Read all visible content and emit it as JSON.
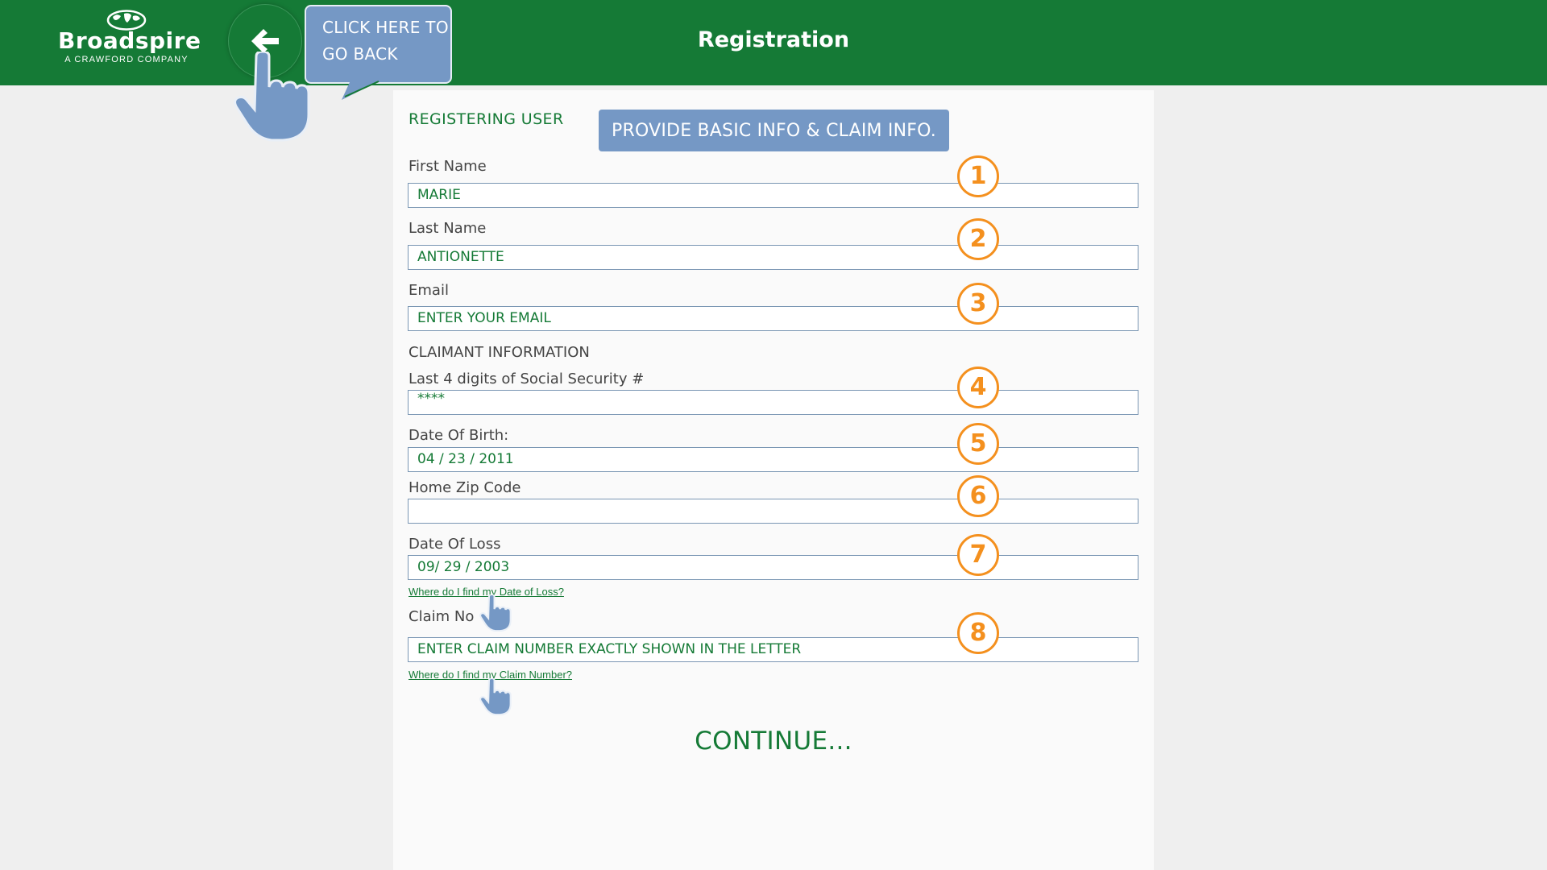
{
  "header": {
    "logo": {
      "name": "Broadspire",
      "subtitle": "A CRAWFORD COMPANY"
    },
    "title": "Registration",
    "back_tooltip": {
      "line1": "CLICK HERE TO",
      "line2": "GO BACK"
    }
  },
  "form": {
    "section_title": "REGISTERING USER",
    "banner": "PROVIDE BASIC INFO & CLAIM INFO.",
    "claimant_heading": "CLAIMANT INFORMATION",
    "fields": [
      {
        "label": "First Name",
        "value": "MARIE",
        "step": "1"
      },
      {
        "label": "Last Name",
        "value": "ANTIONETTE",
        "step": "2"
      },
      {
        "label": "Email",
        "value": "ENTER YOUR EMAIL",
        "step": "3"
      },
      {
        "label": "Last 4 digits of Social Security #",
        "value": "****",
        "step": "4"
      },
      {
        "label": "Date Of Birth:",
        "value": "04 / 23  / 2011",
        "step": "5"
      },
      {
        "label": "Home Zip Code",
        "value": "",
        "step": "6"
      },
      {
        "label": "Date Of Loss",
        "value": "09/ 29  / 2003",
        "step": "7"
      },
      {
        "label": "Claim No",
        "value": "ENTER CLAIM NUMBER EXACTLY SHOWN IN THE LETTER",
        "step": "8"
      }
    ],
    "help_links": {
      "date_of_loss": "Where do I find my Date of Loss?",
      "claim_number": "Where do I find my Claim Number?"
    },
    "continue_label": "CONTINUE..."
  },
  "colors": {
    "brand_green": "#157a36",
    "tooltip_blue": "#7598c5",
    "step_orange": "#f4901e"
  },
  "icons": [
    "globe-logo-icon",
    "arrow-left-icon",
    "pointing-hand-icon"
  ]
}
